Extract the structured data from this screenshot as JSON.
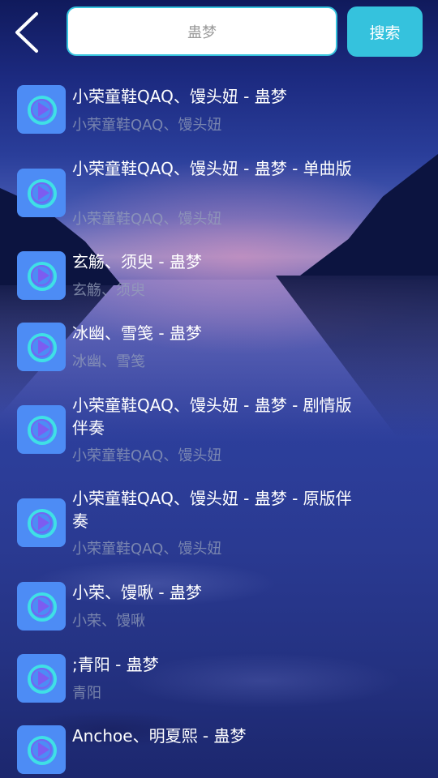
{
  "header": {
    "back_icon": "chevron-left-icon",
    "search_value": "蛊梦",
    "search_button_label": "搜索"
  },
  "results": [
    {
      "title": "小荣童鞋QAQ、馒头妞 - 蛊梦",
      "artist": "小荣童鞋QAQ、馒头妞",
      "icon": "music-play-icon"
    },
    {
      "title": "小荣童鞋QAQ、馒头妞 - 蛊梦 - 单曲版",
      "artist": "小荣童鞋QAQ、馒头妞",
      "icon": "music-play-icon"
    },
    {
      "title": "玄觞、须臾 - 蛊梦",
      "artist": "玄觞、须臾",
      "icon": "music-play-icon"
    },
    {
      "title": "冰幽、雪笺 - 蛊梦",
      "artist": "冰幽、雪笺",
      "icon": "music-play-icon"
    },
    {
      "title": "小荣童鞋QAQ、馒头妞 - 蛊梦 - 剧情版伴奏",
      "artist": "小荣童鞋QAQ、馒头妞",
      "icon": "music-play-icon"
    },
    {
      "title": "小荣童鞋QAQ、馒头妞 - 蛊梦 - 原版伴奏",
      "artist": "小荣童鞋QAQ、馒头妞",
      "icon": "music-play-icon"
    },
    {
      "title": "小荣、馒啾 - 蛊梦",
      "artist": "小荣、馒啾",
      "icon": "music-play-icon"
    },
    {
      "title": ";青阳 - 蛊梦",
      "artist": "青阳",
      "icon": "music-play-icon"
    },
    {
      "title": "Anchoe、明夏熙 - 蛊梦",
      "artist": "",
      "icon": "music-play-icon"
    }
  ],
  "colors": {
    "accent": "#35c2dd",
    "icon_bg": "#4d8cf5",
    "icon_ring_outer": "#3fe0e6",
    "icon_ring_inner": "#7d5cf0"
  }
}
